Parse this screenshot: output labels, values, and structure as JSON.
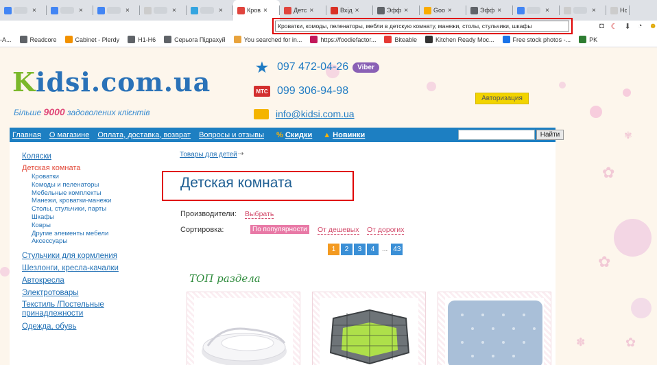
{
  "tabs": [
    {
      "label": "",
      "icon": "docs-icon",
      "color": "#4285f4"
    },
    {
      "label": "",
      "icon": "docs-icon",
      "color": "#4285f4"
    },
    {
      "label": "",
      "icon": "docs-icon",
      "color": "#4285f4"
    },
    {
      "label": "",
      "icon": "blank-icon",
      "color": "#cccccc"
    },
    {
      "label": "",
      "icon": "globe-icon",
      "color": "#34a5e0"
    },
    {
      "label": "Кров",
      "icon": "kidsi-icon",
      "color": "#e0443d",
      "active": true
    },
    {
      "label": "Детс",
      "icon": "kidsi-icon",
      "color": "#e0443d"
    },
    {
      "label": "Вхід",
      "icon": "gmail-icon",
      "color": "#d93025"
    },
    {
      "label": "Эфф",
      "icon": "analytics-icon",
      "color": "#5f6368"
    },
    {
      "label": "Goo",
      "icon": "analytics-bars-icon",
      "color": "#f9ab00"
    },
    {
      "label": "Эфф",
      "icon": "analytics-icon",
      "color": "#5f6368"
    },
    {
      "label": "",
      "icon": "google-icon",
      "color": "#4285f4"
    },
    {
      "label": "",
      "icon": "blank-icon",
      "color": "#cccccc"
    },
    {
      "label": "Нс",
      "icon": "blank-icon",
      "color": "#cccccc"
    }
  ],
  "tooltip": "Кроватки, комоды, пеленаторы, мебли в детскую комнату, манежи, столы, стульчики, шкафы",
  "bookmarks": [
    {
      "label": "-А...",
      "icon": "",
      "color": ""
    },
    {
      "label": "Readcore",
      "icon": "globe-icon",
      "color": "#5f6368"
    },
    {
      "label": "Cabinet - Plerdy",
      "icon": "plerdy-icon",
      "color": "#f29100"
    },
    {
      "label": "H1-H6",
      "icon": "globe-icon",
      "color": "#5f6368"
    },
    {
      "label": "Серьога Підрахуй",
      "icon": "globe-icon",
      "color": "#5f6368"
    },
    {
      "label": "You searched for in...",
      "icon": "flower-icon",
      "color": "#e8a33d"
    },
    {
      "label": "https://foodiefactor...",
      "icon": "foodie-icon",
      "color": "#c2185b"
    },
    {
      "label": "Biteable",
      "icon": "biteable-icon",
      "color": "#e53935"
    },
    {
      "label": "Kitchen Ready Moc...",
      "icon": "mc-icon",
      "color": "#333333"
    },
    {
      "label": "Free stock photos -...",
      "icon": "photos-icon",
      "color": "#1a73e8"
    },
    {
      "label": "PK",
      "icon": "pk-icon",
      "color": "#2e7d32"
    }
  ],
  "site": {
    "logo_k": "K",
    "logo_rest": "idsi.com.ua",
    "tagline_pre": "Більше ",
    "tagline_num": "9000",
    "tagline_post": " задоволених клієнтів",
    "phone1": "097 472-04-26",
    "viber": "Viber",
    "operator1": "Київстар",
    "phone2": "099 306-94-98",
    "operator2": "МТС",
    "email": "info@kidsi.com.ua",
    "auth": "Авторизация"
  },
  "nav": {
    "items": [
      "Главная",
      "О магазине",
      "Оплата, доставка, возврат",
      "Вопросы и отзывы"
    ],
    "discounts": "Скидки",
    "news": "Новинки",
    "search_button": "Найти"
  },
  "sidebar": {
    "strollers": "Коляски",
    "kids_room": "Детская комната",
    "sub": [
      "Кроватки",
      "Комоды и пеленаторы",
      "Мебельные комплекты",
      "Манежи, кроватки-манежи",
      "Столы, стульчики, парты",
      "Шкафы",
      "Ковры",
      "Другие элементы мебели",
      "Аксессуары"
    ],
    "more": [
      "Стульчики для кормления",
      "Шезлонги, кресла-качалки",
      "Автокресла",
      "Электротовары",
      "Текстиль /Постельные принадлежности",
      "Одежда, обувь"
    ]
  },
  "main": {
    "breadcrumb": "Товары для детей",
    "title": "Детская комната",
    "producers_label": "Производители:",
    "producers_link": "Выбрать",
    "sort_label": "Сортировка:",
    "sort_popular": "По популярности",
    "sort_cheap": "От дешевых",
    "sort_expensive": "От дорогих",
    "pages": [
      "1",
      "2",
      "3",
      "4"
    ],
    "pages_ellipsis": "...",
    "pages_last": "43",
    "top_title": "ТОП раздела"
  }
}
